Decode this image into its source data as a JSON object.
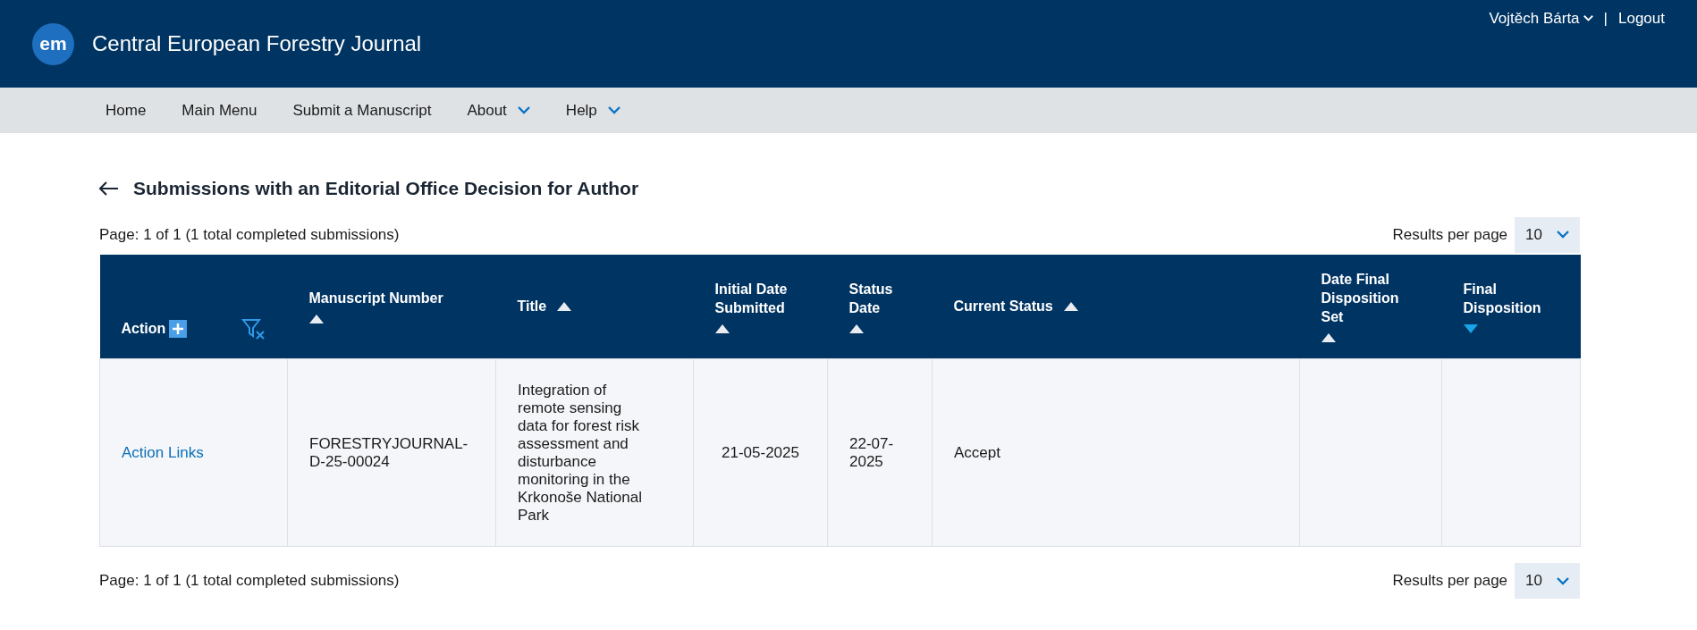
{
  "header": {
    "logo": "em",
    "journal": "Central European Forestry Journal",
    "user": "Vojtěch Bárta",
    "separator": "|",
    "logout": "Logout"
  },
  "nav": [
    {
      "label": "Home",
      "dropdown": false
    },
    {
      "label": "Main Menu",
      "dropdown": false
    },
    {
      "label": "Submit a Manuscript",
      "dropdown": false
    },
    {
      "label": "About",
      "dropdown": true
    },
    {
      "label": "Help",
      "dropdown": true
    }
  ],
  "page_title": "Submissions with an Editorial Office Decision for Author",
  "top_pager": {
    "summary": "Page: 1 of 1 (1 total completed submissions)",
    "results_label": "Results per page",
    "per_page": "10"
  },
  "table": {
    "columns": [
      {
        "label": "Action",
        "kind": "action"
      },
      {
        "label": "Manuscript Number",
        "kind": "sortable",
        "descending": false,
        "selected": false
      },
      {
        "label": "Title",
        "kind": "sortable",
        "descending": false,
        "selected": false
      },
      {
        "label": "Initial Date Submitted",
        "kind": "sortable",
        "descending": false,
        "selected": false
      },
      {
        "label": "Status Date",
        "kind": "sortable",
        "descending": false,
        "selected": false
      },
      {
        "label": "Current Status",
        "kind": "sortable",
        "descending": false,
        "selected": false
      },
      {
        "label": "Date Final Disposition Set",
        "kind": "sortable",
        "descending": false,
        "selected": false
      },
      {
        "label": "Final Disposition",
        "kind": "sortable",
        "descending": true,
        "selected": true
      }
    ],
    "rows": [
      {
        "cells": [
          {
            "kind": "link",
            "text": "Action Links"
          },
          {
            "kind": "text",
            "text": "FORESTRYJOURNAL-D-25-00024"
          },
          {
            "kind": "text",
            "text": "Integration of remote sensing data for forest risk assessment and disturbance monitoring in the Krkonoše National Park"
          },
          {
            "kind": "center",
            "text": "21-05-2025"
          },
          {
            "kind": "text",
            "text": "22-07-2025"
          },
          {
            "kind": "text",
            "text": "Accept"
          }
        ]
      }
    ]
  },
  "bottom_pager": {
    "summary": "Page: 1 of 1 (1 total completed submissions)",
    "results_label": "Results per page",
    "per_page": "10"
  }
}
